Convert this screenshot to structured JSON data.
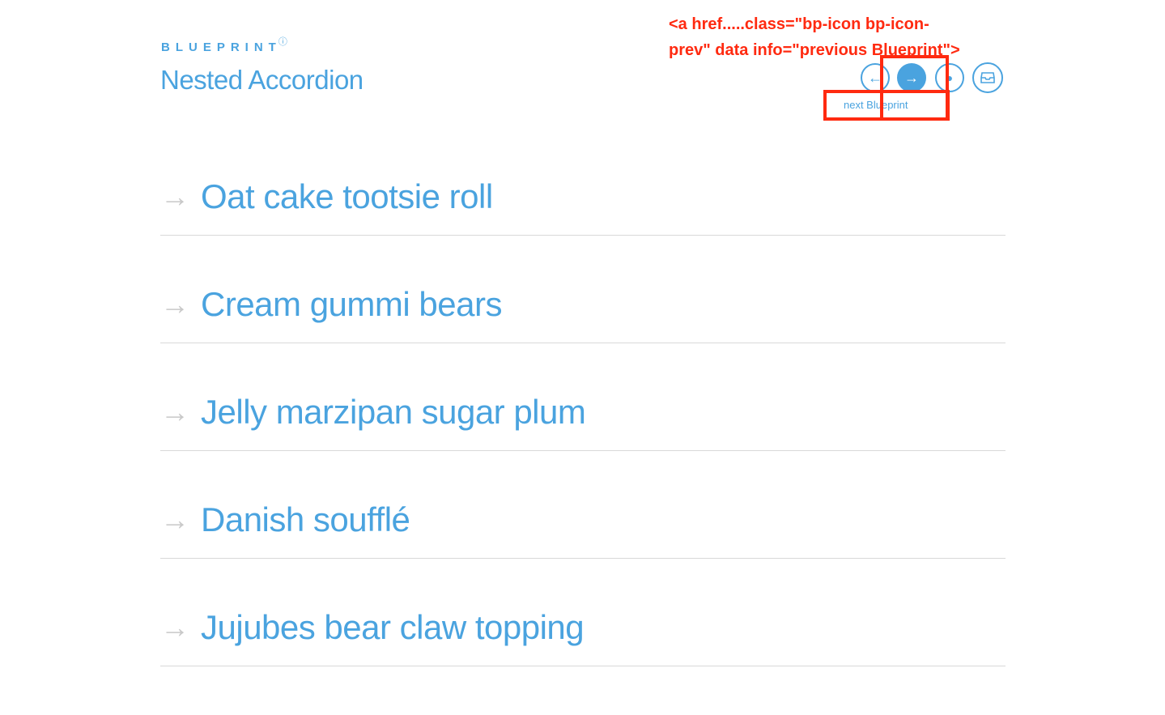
{
  "header": {
    "brand": "BLUEPRINT",
    "brand_help_icon": "question-circle-icon",
    "title": "Nested Accordion"
  },
  "nav": {
    "prev_icon": "arrow-left-icon",
    "next_icon": "arrow-right-icon",
    "info_icon": "info-icon",
    "archive_icon": "archive-box-icon",
    "tooltip": "next Blueprint"
  },
  "annotation": {
    "text": "<a href.....class=\"bp-icon bp-icon-prev\" data info=\"previous Blueprint\">",
    "color": "#ff2a10"
  },
  "accordion": {
    "items": [
      {
        "label": "Oat cake tootsie roll"
      },
      {
        "label": "Cream gummi bears"
      },
      {
        "label": "Jelly marzipan sugar plum"
      },
      {
        "label": "Danish soufflé"
      },
      {
        "label": "Jujubes bear claw topping"
      }
    ]
  },
  "colors": {
    "accent": "#4aa3df",
    "arrow": "#c9c9c9",
    "divider": "#d9d9d9"
  }
}
